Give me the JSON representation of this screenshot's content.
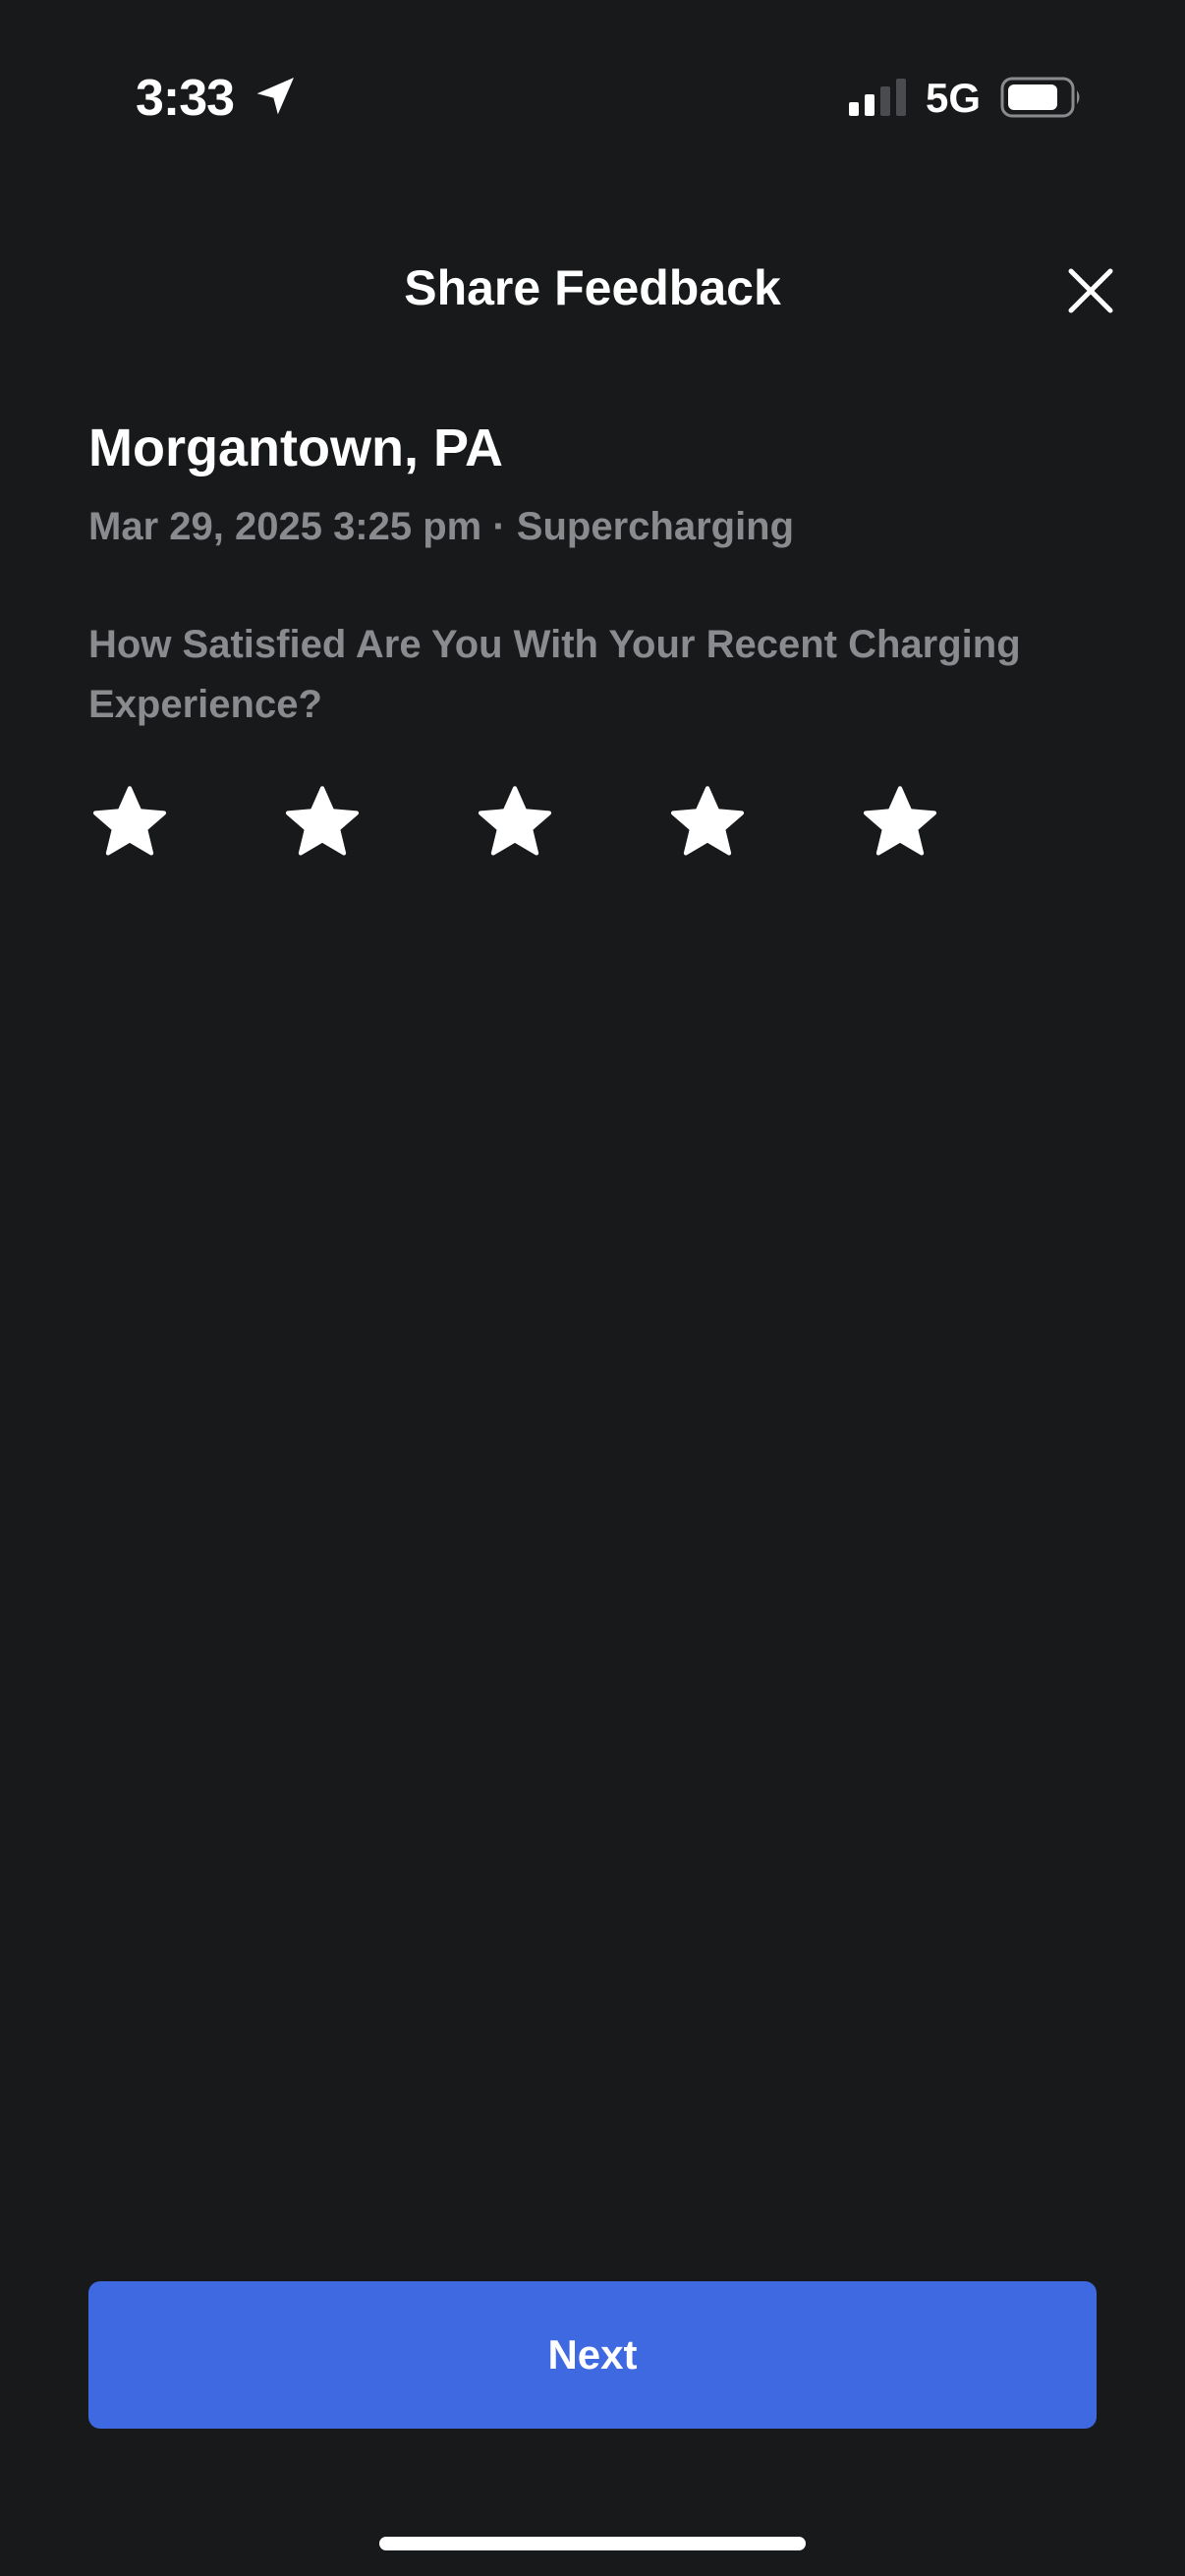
{
  "status_bar": {
    "time": "3:33",
    "network": "5G",
    "location_icon": "location-arrow-icon",
    "signal_icon": "cellular-signal-icon",
    "battery_icon": "battery-icon"
  },
  "header": {
    "title": "Share Feedback",
    "close_icon": "close-icon"
  },
  "session": {
    "location": "Morgantown, PA",
    "details": "Mar 29, 2025 3:25 pm · Supercharging"
  },
  "rating": {
    "question": "How Satisfied Are You With Your Recent Charging Experience?",
    "max_stars": 5,
    "star_icon": "star-icon"
  },
  "footer": {
    "next_label": "Next"
  },
  "colors": {
    "background": "#18191b",
    "text_primary": "#ffffff",
    "text_secondary": "#8a8b8e",
    "accent": "#3f69e0"
  }
}
